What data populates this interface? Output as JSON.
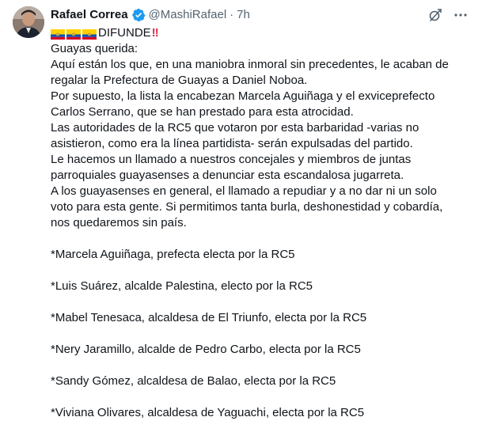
{
  "tweet": {
    "author_name": "Rafael Correa",
    "handle": "@MashiRafael",
    "separator": "·",
    "time": "7h",
    "headline_text": "DIFUNDE",
    "headline_exclaim": "‼",
    "headline_flag_icons": [
      "ecuador-flag-icon",
      "ecuador-flag-icon",
      "ecuador-flag-icon"
    ],
    "colors": {
      "verified": "#1d9bf0",
      "muted": "#536471",
      "text": "#0f1419",
      "alert_red": "#dd2e44",
      "flag_yellow": "#ffd100",
      "flag_blue": "#0052b4",
      "flag_red": "#d80027"
    },
    "paragraph_lines": [
      "Guayas querida:",
      "Aquí están los que, en una maniobra inmoral sin precedentes, le acaban de",
      "regalar la Prefectura de Guayas a Daniel Noboa.",
      "Por supuesto, la lista la encabezan Marcela Aguiñaga y el exviceprefecto",
      "Carlos Serrano, que se han prestado para esta atrocidad.",
      "Las autoridades de la RC5 que votaron por esta barbaridad  -varias no",
      "asistieron, como era la línea partidista- serán expulsadas del partido.",
      "Le hacemos un llamado a nuestros concejales y miembros de juntas",
      "parroquiales guayasenses a denunciar esta escandalosa jugarreta.",
      "A los guayasenses en general, el llamado a repudiar y a no dar ni un solo",
      "voto para esta gente. Si permitimos tanta burla, deshonestidad y cobardía,",
      "nos quedaremos sin país."
    ],
    "list_items": [
      "*Marcela Aguiñaga, prefecta electa por la RC5",
      "*Luis Suárez, alcalde Palestina, electo por la RC5",
      "*Mabel Tenesaca, alcaldesa de El Triunfo, electa por la RC5",
      "*Nery Jaramillo, alcalde de Pedro Carbo, electa por la RC5",
      "*Sandy Gómez, alcaldesa de Balao, electa por la RC5",
      "*Viviana Olivares, alcaldesa de Yaguachi, electa por la RC5"
    ]
  }
}
